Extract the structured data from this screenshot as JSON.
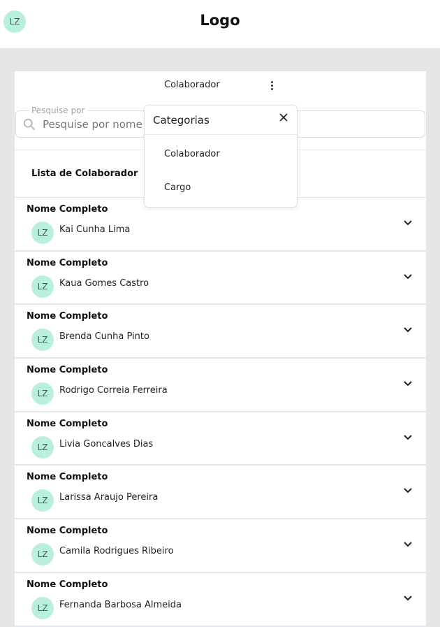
{
  "header": {
    "avatar_initials": "LZ",
    "logo_text": "Logo"
  },
  "category_bar": {
    "selected_category": "Colaborador",
    "menu_icon": "kebab-menu-icon"
  },
  "search": {
    "legend": "Pesquise por",
    "placeholder": "Pesquise por nome",
    "value": "",
    "icon": "search-icon"
  },
  "list": {
    "title": "Lista de Colaborador",
    "field_label": "Nome Completo",
    "avatar_initials": "LZ",
    "rows": [
      {
        "label": "Nome Completo",
        "initials": "LZ",
        "name": "Kai Cunha Lima"
      },
      {
        "label": "Nome Completo",
        "initials": "LZ",
        "name": "Kaua Gomes Castro"
      },
      {
        "label": "Nome Completo",
        "initials": "LZ",
        "name": "Brenda Cunha Pinto"
      },
      {
        "label": "Nome Completo",
        "initials": "LZ",
        "name": "Rodrigo Correia Ferreira"
      },
      {
        "label": "Nome Completo",
        "initials": "LZ",
        "name": "Livia Goncalves Dias"
      },
      {
        "label": "Nome Completo",
        "initials": "LZ",
        "name": "Larissa Araujo Pereira"
      },
      {
        "label": "Nome Completo",
        "initials": "LZ",
        "name": "Camila Rodrigues Ribeiro"
      },
      {
        "label": "Nome Completo",
        "initials": "LZ",
        "name": "Fernanda Barbosa Almeida"
      }
    ]
  },
  "dropdown": {
    "title": "Categorias",
    "items": [
      "Colaborador",
      "Cargo"
    ]
  },
  "colors": {
    "avatar_bg": "#b8f0dc",
    "page_bg": "#e6e6e6",
    "panel_bg": "#ffffff"
  }
}
